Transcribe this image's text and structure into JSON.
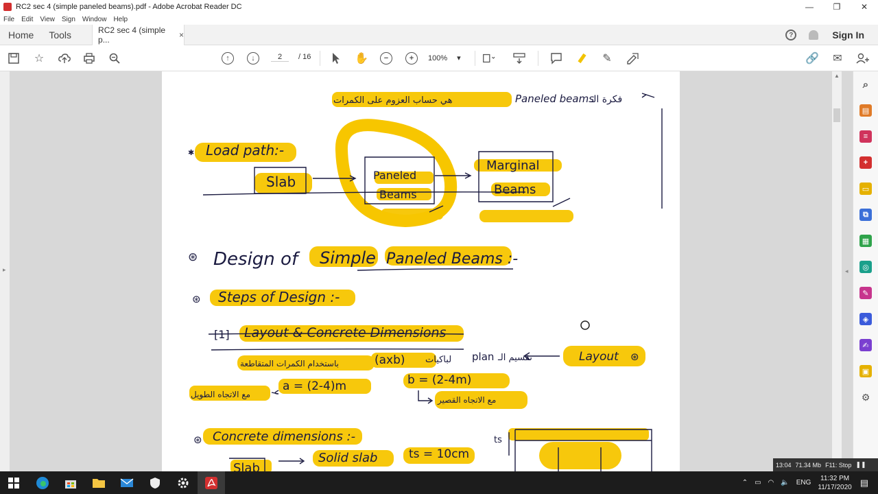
{
  "window": {
    "title": "RC2 sec 4 (simple paneled beams).pdf - Adobe Acrobat Reader DC",
    "minimize": "—",
    "maximize": "❐",
    "close": "✕"
  },
  "menu": [
    "File",
    "Edit",
    "View",
    "Sign",
    "Window",
    "Help"
  ],
  "tabs": {
    "home": "Home",
    "tools": "Tools",
    "document": "RC2 sec 4 (simple p...",
    "close": "×",
    "help_icon": "?",
    "sign_in": "Sign In"
  },
  "toolbar": {
    "page_current": "2",
    "page_total": "/ 16",
    "zoom": "100%",
    "zoom_arrow": "▾"
  },
  "page_content": {
    "line1_en": "Paneled beams",
    "line1_ar_left": "هي حساب العزوم على الكمرات",
    "line1_ar_right": "فكرة الـ",
    "load_path": "Load path:-",
    "box_slab": "Slab",
    "box_paneled_1": "Paneled",
    "box_paneled_2": "Beams",
    "box_marginal_1": "Marginal",
    "box_marginal_2": "Beams",
    "heading_design_1": "Design of",
    "heading_design_2": "Simple",
    "heading_design_3": "Paneled Beams :-",
    "steps": "Steps of Design :-",
    "step1": "Layout & Concrete Dimensions",
    "layout_label": "Layout",
    "ar_divide": "تقسيم الـ",
    "plan": "plan",
    "ar_panels": "لباكيات",
    "axb": "(axb)",
    "ar_using": "باستخدام الكمرات المتقاطعة",
    "a_eq": "a = (2-4)m",
    "b_eq": "b = (2-4m)",
    "ar_long": "مع الاتجاه الطويل",
    "ar_short": "مع الاتجاه القصير",
    "concrete_dims": "Concrete dimensions :-",
    "slab2": "Slab",
    "solid_slab": "Solid slab",
    "ts_eq": "ts = 10cm",
    "ts_label": "ts"
  },
  "status_overlay": {
    "time": "13:04",
    "mem": "71.34 Mb",
    "key": "F11: Stop"
  },
  "taskbar": {
    "lang": "ENG",
    "time": "11:32 PM",
    "date": "11/17/2020"
  },
  "colors": {
    "highlight": "#f7c600",
    "acrobat_red": "#d32f2f",
    "taskbar": "#1c1c1c"
  }
}
